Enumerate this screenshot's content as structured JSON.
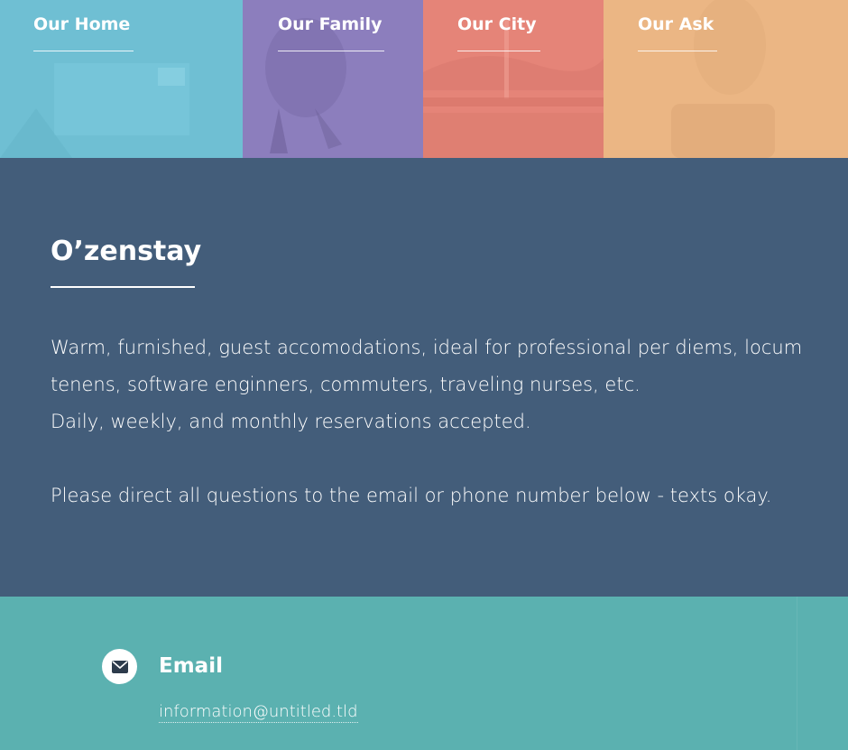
{
  "nav_tiles": [
    {
      "label": "Our Home",
      "color": "#6fbfd3"
    },
    {
      "label": "Our Family",
      "color": "#8c7ebd"
    },
    {
      "label": "Our City",
      "color": "#e58478"
    },
    {
      "label": "Our Ask",
      "color": "#ebb684"
    }
  ],
  "banner": {
    "title": "O’zenstay",
    "description_lines": [
      "Warm, furnished, guest accomodations, ideal for professional per diems, locum tenens, software enginners, commuters, traveling nurses, etc.",
      "Daily, weekly, and monthly reservations accepted."
    ],
    "note": "Please direct all questions to the email or phone number below - texts okay.",
    "background": "#435d7a"
  },
  "contact": {
    "email_title": "Email",
    "email_icon": "envelope-icon",
    "email_address": "information@untitled.tld",
    "background": "#5bb1b0"
  }
}
